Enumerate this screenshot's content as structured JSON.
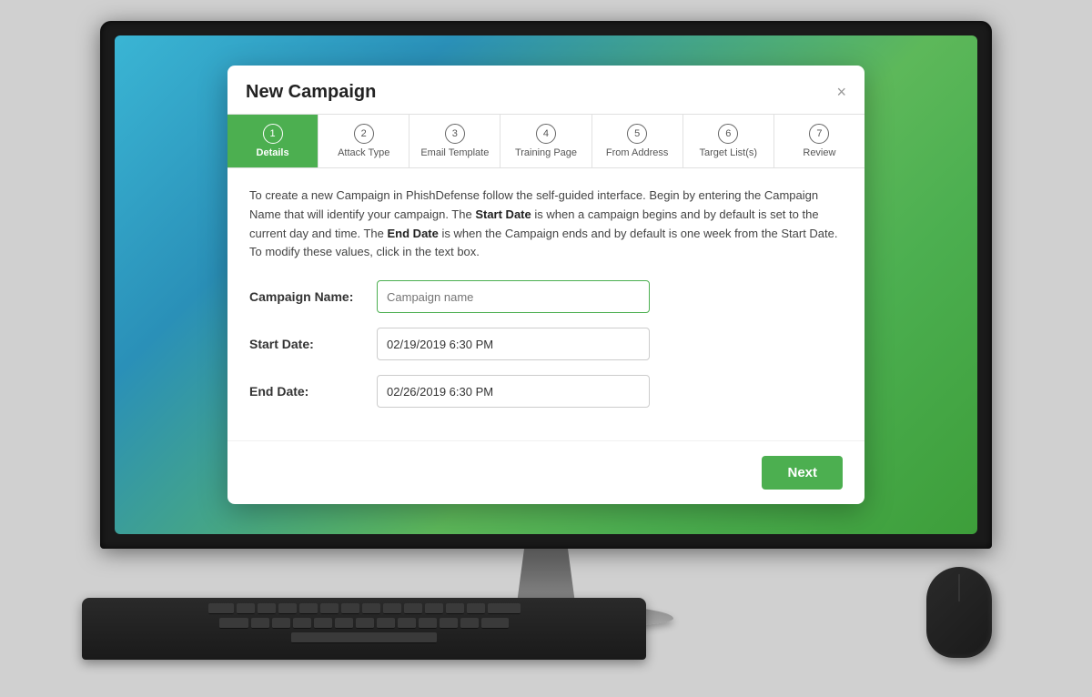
{
  "modal": {
    "title": "New Campaign",
    "close_label": "×",
    "description_part1": "To create a new Campaign in PhishDefense follow the self-guided interface. Begin by entering the Campaign Name that will identify your campaign. The ",
    "description_bold1": "Start Date",
    "description_part2": " is when a campaign begins and by default is set to the current day and time. The ",
    "description_bold2": "End Date",
    "description_part3": " is when the Campaign ends and by default is one week from the Start Date. To modify these values, click in the text box.",
    "steps": [
      {
        "number": "1",
        "label": "Details",
        "active": true
      },
      {
        "number": "2",
        "label": "Attack Type",
        "active": false
      },
      {
        "number": "3",
        "label": "Email Template",
        "active": false
      },
      {
        "number": "4",
        "label": "Training Page",
        "active": false
      },
      {
        "number": "5",
        "label": "From Address",
        "active": false
      },
      {
        "number": "6",
        "label": "Target List(s)",
        "active": false
      },
      {
        "number": "7",
        "label": "Review",
        "active": false
      }
    ],
    "form": {
      "campaign_name_label": "Campaign Name:",
      "campaign_name_placeholder": "Campaign name",
      "campaign_name_value": "",
      "start_date_label": "Start Date:",
      "start_date_value": "02/19/2019 6:30 PM",
      "end_date_label": "End Date:",
      "end_date_value": "02/26/2019 6:30 PM"
    },
    "next_button_label": "Next"
  }
}
